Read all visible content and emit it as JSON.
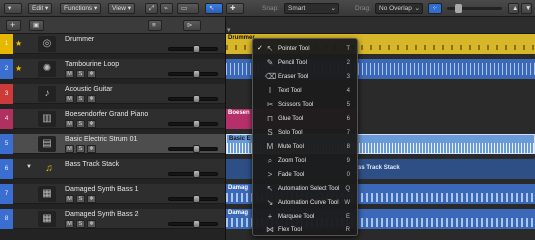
{
  "toolbar": {
    "edit_label": "Edit",
    "functions_label": "Functions",
    "view_label": "View",
    "snap_label": "Snap:",
    "snap_value": "Smart",
    "drag_label": "Drag:",
    "drag_value": "No Overlap"
  },
  "tracks": [
    {
      "number": "1",
      "name": "Drummer",
      "color": "#e6b800",
      "selected": false,
      "fader": 0.55,
      "icon": "drum-icon"
    },
    {
      "number": "2",
      "name": "Tambourine Loop",
      "color": "#3a6ed0",
      "selected": false,
      "fader": 0.55,
      "icon": "tambourine-icon"
    },
    {
      "number": "3",
      "name": "Acoustic Guitar",
      "color": "#cc3a3a",
      "selected": false,
      "fader": 0.55,
      "icon": "guitar-icon"
    },
    {
      "number": "4",
      "name": "Boesendorfer Grand Piano",
      "color": "#b0305f",
      "selected": false,
      "fader": 0.55,
      "icon": "piano-icon"
    },
    {
      "number": "5",
      "name": "Basic Electric Strum 01",
      "color": "#3a6ed0",
      "selected": true,
      "fader": 0.55,
      "icon": "amp-icon"
    },
    {
      "number": "6",
      "name": "Bass Track Stack",
      "color": "#3a6ed0",
      "selected": false,
      "fader": 0.55,
      "icon": "bass-icon"
    },
    {
      "number": "7",
      "name": "Damaged Synth Bass 1",
      "color": "#3a6ed0",
      "selected": false,
      "fader": 0.55,
      "icon": "synth-icon"
    },
    {
      "number": "8",
      "name": "Damaged Synth Bass 2",
      "color": "#3a6ed0",
      "selected": false,
      "fader": 0.55,
      "icon": "synth-icon"
    }
  ],
  "track_buttons": {
    "mute": "M",
    "solo": "S",
    "freeze": "❄"
  },
  "regions": {
    "drummer": "Drummer",
    "boesendorfer": "Boesen",
    "basic": "Basic E",
    "bass_track_stack": "ss Track Stack",
    "damaged_1": "Damag",
    "damaged_2": "Damag"
  },
  "tool_menu": {
    "items": [
      {
        "label": "Pointer Tool",
        "key": "T",
        "icon": "pointer-icon",
        "checked": true
      },
      {
        "label": "Pencil Tool",
        "key": "2",
        "icon": "pencil-icon",
        "checked": false
      },
      {
        "label": "Eraser Tool",
        "key": "3",
        "icon": "eraser-icon",
        "checked": false
      },
      {
        "label": "Text Tool",
        "key": "4",
        "icon": "text-icon",
        "checked": false
      },
      {
        "label": "Scissors Tool",
        "key": "5",
        "icon": "scissors-icon",
        "checked": false
      },
      {
        "label": "Glue Tool",
        "key": "6",
        "icon": "glue-icon",
        "checked": false
      },
      {
        "label": "Solo Tool",
        "key": "7",
        "icon": "solo-icon",
        "checked": false
      },
      {
        "label": "Mute Tool",
        "key": "8",
        "icon": "mute-icon",
        "checked": false
      },
      {
        "label": "Zoom Tool",
        "key": "9",
        "icon": "zoom-icon",
        "checked": false
      },
      {
        "label": "Fade Tool",
        "key": "0",
        "icon": "fade-icon",
        "checked": false
      },
      {
        "label": "Automation Select Tool",
        "key": "Q",
        "icon": "automation-select-icon",
        "checked": false
      },
      {
        "label": "Automation Curve Tool",
        "key": "W",
        "icon": "automation-curve-icon",
        "checked": false
      },
      {
        "label": "Marquee Tool",
        "key": "E",
        "icon": "marquee-icon",
        "checked": false
      },
      {
        "label": "Flex Tool",
        "key": "R",
        "icon": "flex-icon",
        "checked": false
      }
    ]
  },
  "colors": {
    "drummer_region": "#d8b62a",
    "audio_region": "#3b69b8",
    "selected_region": "#6a9bd8",
    "piano_region": "#b5306a",
    "accent_blue": "#2f6fd0"
  }
}
